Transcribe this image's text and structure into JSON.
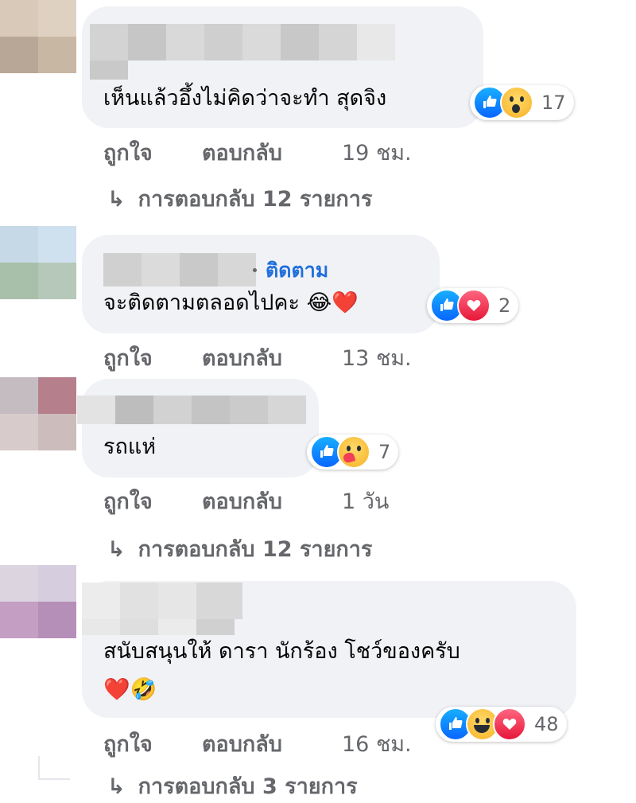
{
  "comments": [
    {
      "text": "เห็นแล้วอึ้งไม่คิดว่าจะทำ สุดจิง",
      "emoji": "",
      "reactions": [
        "like-icon",
        "wow-icon"
      ],
      "reaction_count": "17",
      "actions": {
        "like": "ถูกใจ",
        "reply": "ตอบกลับ",
        "time": "19 ชม."
      },
      "replies_label": "การตอบกลับ 12 รายการ"
    },
    {
      "follow": "ติดตาม",
      "text": "จะติดตามตลอดไปคะ",
      "emoji": "😂❤️",
      "reactions": [
        "like-icon",
        "love-icon"
      ],
      "reaction_count": "2",
      "actions": {
        "like": "ถูกใจ",
        "reply": "ตอบกลับ",
        "time": "13 ชม."
      }
    },
    {
      "text": "รถแห่",
      "emoji": "",
      "reactions": [
        "like-icon",
        "care-icon"
      ],
      "reaction_count": "7",
      "actions": {
        "like": "ถูกใจ",
        "reply": "ตอบกลับ",
        "time": "1 วัน"
      },
      "replies_label": "การตอบกลับ 12 รายการ"
    },
    {
      "text": "สนับสนุนให้ ดารา นักร้อง โชว์ของครับ",
      "emoji": "❤️🤣",
      "reactions": [
        "like-icon",
        "haha-icon",
        "love-icon"
      ],
      "reaction_count": "48",
      "actions": {
        "like": "ถูกใจ",
        "reply": "ตอบกลับ",
        "time": "16 ชม."
      },
      "replies_label": "การตอบกลับ 3 รายการ"
    }
  ],
  "colors": {
    "bubble": "#f0f2f5",
    "meta_text": "#65676b",
    "follow_link": "#216fdb",
    "like": "#0866ff",
    "love": "#f33e58"
  }
}
